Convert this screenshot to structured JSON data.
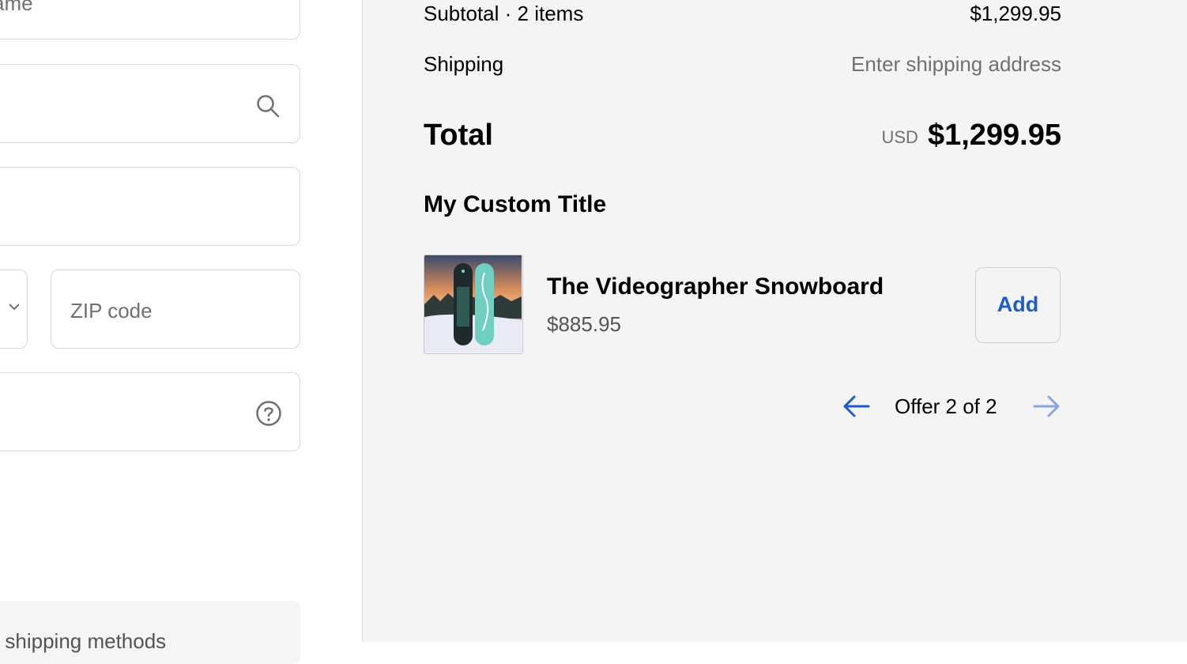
{
  "form": {
    "field1_placeholder": "ame",
    "zip_placeholder": "ZIP code",
    "shipping_methods_text": "able shipping methods"
  },
  "summary": {
    "subtotal_label": "Subtotal · 2 items",
    "subtotal_value": "$1,299.95",
    "shipping_label": "Shipping",
    "shipping_value": "Enter shipping address",
    "total_label": "Total",
    "total_currency": "USD",
    "total_value": "$1,299.95"
  },
  "upsell": {
    "title": "My Custom Title",
    "product_name": "The Videographer Snowboard",
    "product_price": "$885.95",
    "add_label": "Add",
    "pager_label": "Offer 2 of 2"
  },
  "colors": {
    "accent": "#1f5cc9",
    "panel_bg": "#f4f4f4"
  },
  "icons": [
    "search-icon",
    "help-icon",
    "chevron-down-icon",
    "arrow-left-icon",
    "arrow-right-icon"
  ]
}
